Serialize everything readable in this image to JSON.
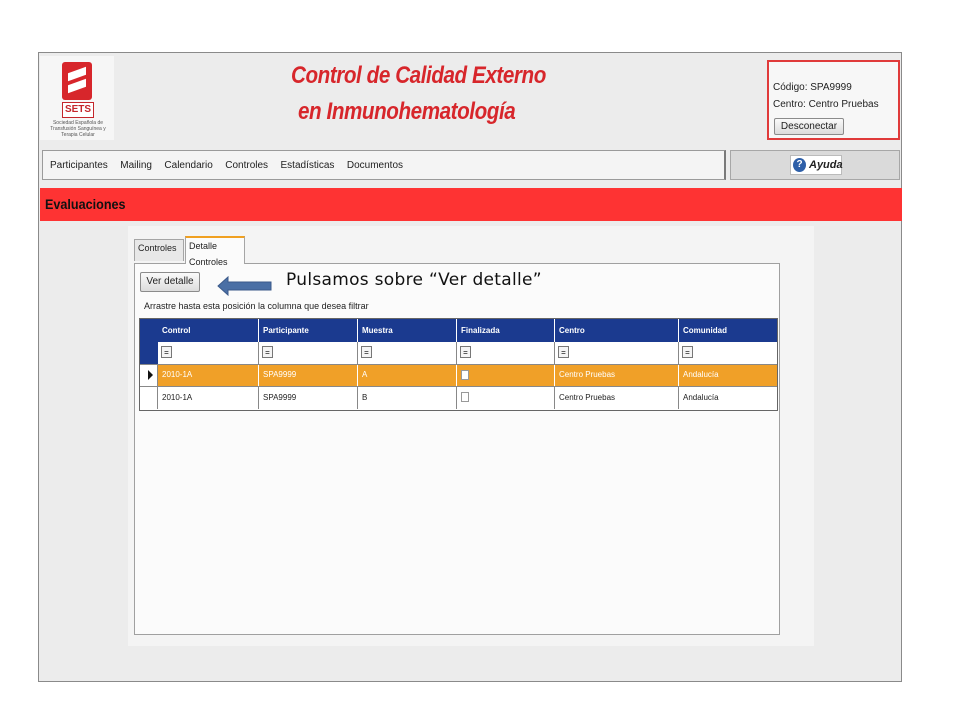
{
  "header": {
    "logo_acronym": "SETS",
    "logo_caption": "Sociedad Española de Transfusión Sanguínea y Terapia Celular",
    "title_line1": "Control de Calidad Externo",
    "title_line2": "en Inmunohematología"
  },
  "user": {
    "code_label": "Código:",
    "code_value": "SPA9999",
    "center_label": "Centro:",
    "center_value": "Centro Pruebas",
    "disconnect_label": "Desconectar"
  },
  "nav": {
    "items": [
      "Participantes",
      "Mailing",
      "Calendario",
      "Controles",
      "Estadísticas",
      "Documentos"
    ],
    "help_label": "Ayuda",
    "help_icon": "question-icon"
  },
  "section_title": "Evaluaciones",
  "tabs": [
    "Controles",
    "Detalle Controles"
  ],
  "active_tab": "Detalle Controles",
  "actions": {
    "ver_detalle": "Ver detalle"
  },
  "filter_hint": "Arrastre hasta esta posición la columna que desea filtrar",
  "grid": {
    "columns": [
      "Control",
      "Participante",
      "Muestra",
      "Finalizada",
      "Centro",
      "Comunidad"
    ],
    "filter_button": "=",
    "rows": [
      {
        "control": "2010-1A",
        "participante": "SPA9999",
        "muestra": "A",
        "finalizada": false,
        "centro": "Centro Pruebas",
        "comunidad": "Andalucía",
        "selected": true
      },
      {
        "control": "2010-1A",
        "participante": "SPA9999",
        "muestra": "B",
        "finalizada": false,
        "centro": "Centro Pruebas",
        "comunidad": "Andalucía",
        "selected": false
      }
    ],
    "selected_color": "#f0a028",
    "header_color": "#1b3a8f"
  },
  "annotation": {
    "text": "Pulsamos sobre “Ver detalle”",
    "arrow_color": "#4a6fa5"
  },
  "colors": {
    "brand_red": "#d7262b",
    "section_red": "#fe3333"
  }
}
